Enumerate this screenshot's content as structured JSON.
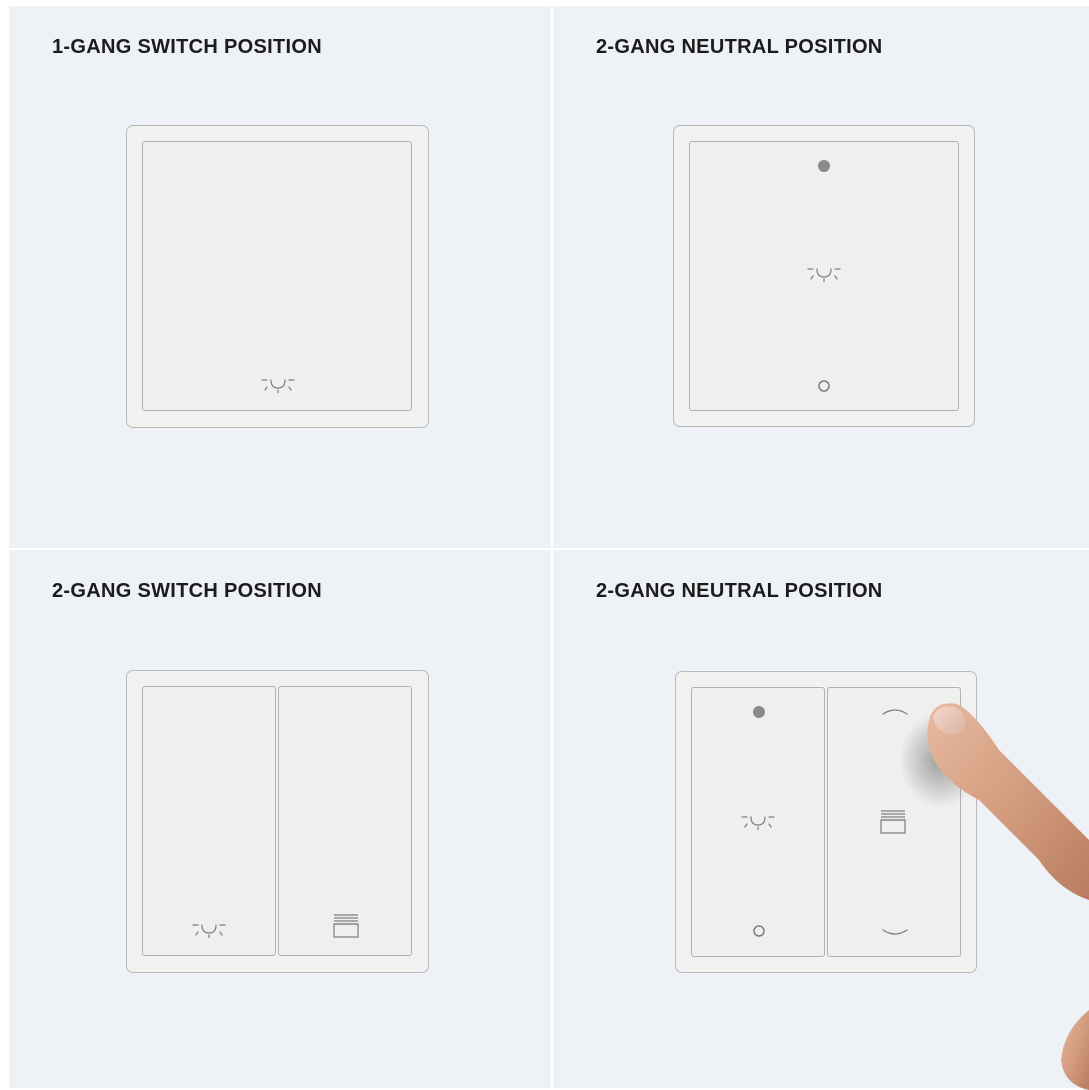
{
  "panels": [
    {
      "title": "1-GANG SWITCH POSITION"
    },
    {
      "title": "2-GANG NEUTRAL POSITION"
    },
    {
      "title": "2-GANG SWITCH POSITION"
    },
    {
      "title": "2-GANG NEUTRAL POSITION"
    }
  ],
  "colors": {
    "cell_background": "#eef1f6",
    "plate": "#f1f1f0",
    "outline": "#b1b1b1",
    "indicator_dot": "#8a8a8a",
    "symbol_stroke": "#7d7d7d"
  },
  "icons": [
    "light-icon",
    "blind-icon",
    "dot-on-icon",
    "dot-off-icon",
    "chevron-up-icon",
    "chevron-down-icon"
  ]
}
